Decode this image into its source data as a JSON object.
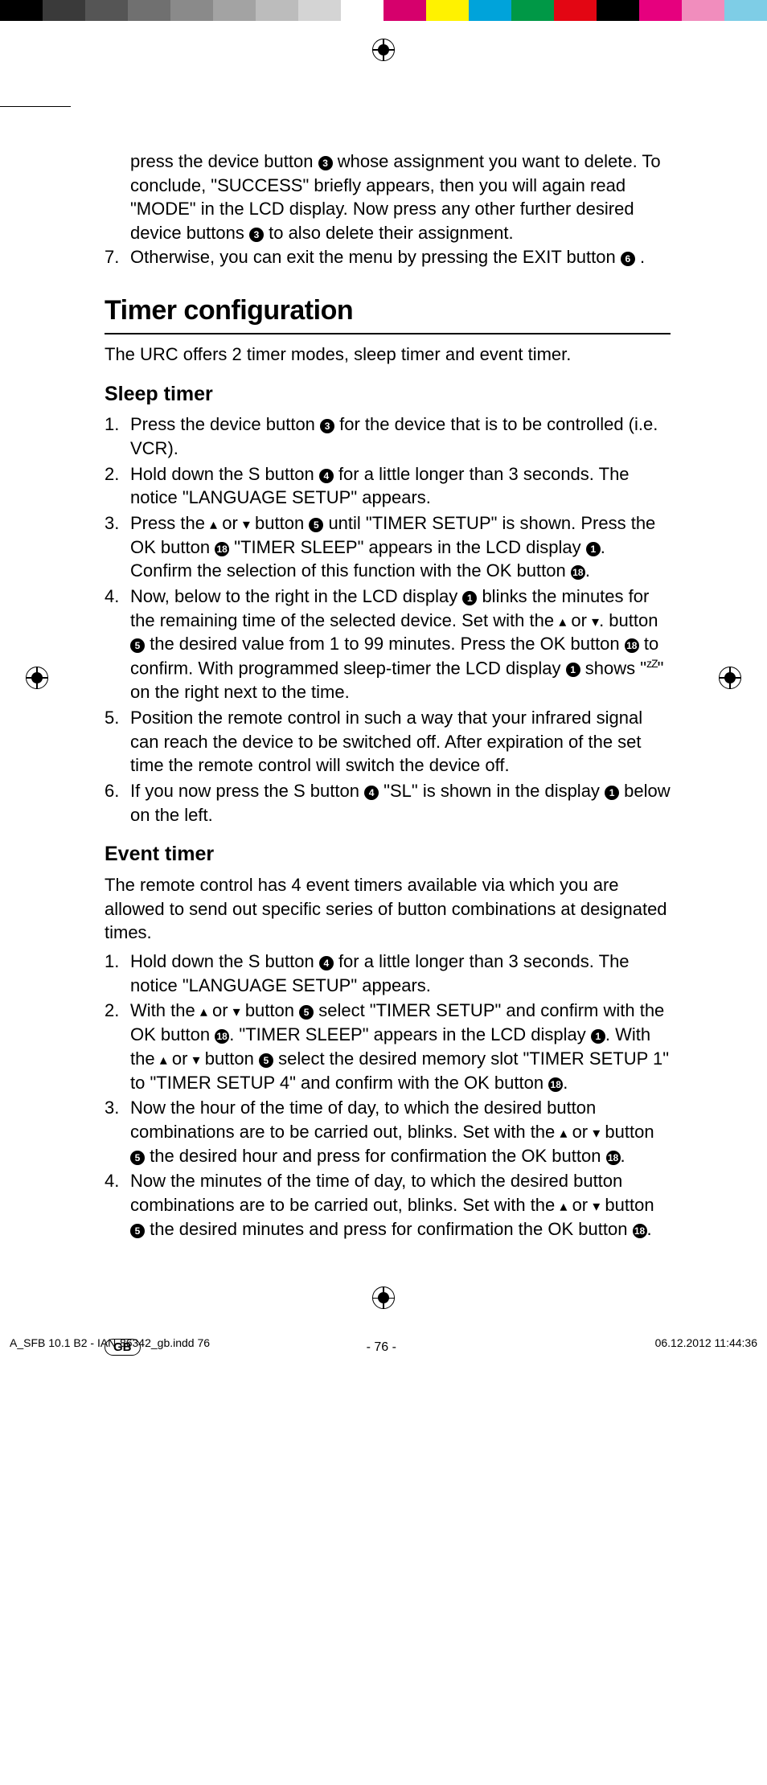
{
  "colorbar": [
    "#000000",
    "#3a3a3a",
    "#555555",
    "#707070",
    "#8a8a8a",
    "#a3a3a3",
    "#bcbcbc",
    "#d4d4d4",
    "#ffffff",
    "#d6006c",
    "#fff200",
    "#00a3da",
    "#009846",
    "#e30613",
    "#000000",
    "#e6007e",
    "#f18dbd",
    "#7ecde6"
  ],
  "continued": {
    "p1_a": "press the device button ",
    "p1_ref1": "3",
    "p1_b": " whose assignment you want to delete. To conclude, \"SUCCESS\" briefly appears, then you will again read \"MODE\" in the LCD display. Now press any other further desired device buttons ",
    "p1_ref2": "3",
    "p1_c": " to also delete their assignment.",
    "li7_num": "7.",
    "li7_a": "Otherwise, you can exit the menu by pressing the EXIT button ",
    "li7_ref": "6",
    "li7_b": "."
  },
  "h1": "Timer configuration",
  "intro1": "The URC offers 2 timer modes, sleep timer and event timer.",
  "h2a": "Sleep timer",
  "sleep": [
    {
      "num": "1.",
      "parts": [
        {
          "t": "Press the device button "
        },
        {
          "c": "3"
        },
        {
          "t": " for the device that is to be controlled (i.e. VCR)."
        }
      ]
    },
    {
      "num": "2.",
      "parts": [
        {
          "t": "Hold down the S button "
        },
        {
          "c": "4"
        },
        {
          "t": " for a little longer than 3 seconds. The notice \"LANGUAGE SETUP\" appears."
        }
      ]
    },
    {
      "num": "3.",
      "parts": [
        {
          "t": "Press the "
        },
        {
          "up": true
        },
        {
          "t": " or "
        },
        {
          "dn": true
        },
        {
          "t": " button "
        },
        {
          "c": "5"
        },
        {
          "t": " until \"TIMER SETUP\" is shown. Press the OK button "
        },
        {
          "c": "18"
        },
        {
          "t": " \"TIMER SLEEP\" appears in the LCD display "
        },
        {
          "c": "1"
        },
        {
          "t": ".  Confirm the selection of this function with the OK button "
        },
        {
          "c": "18"
        },
        {
          "t": "."
        }
      ]
    },
    {
      "num": "4.",
      "parts": [
        {
          "t": "Now, below to the right in the LCD display "
        },
        {
          "c": "1"
        },
        {
          "t": " blinks the minutes for the remaining time of the selected device. Set with the "
        },
        {
          "up": true
        },
        {
          "t": " or "
        },
        {
          "dn": true
        },
        {
          "t": ". button "
        },
        {
          "c": "5"
        },
        {
          "t": " the desired value from 1 to 99 minutes. Press the OK button "
        },
        {
          "c": "18"
        },
        {
          "t": " to confirm. With programmed sleep-timer the LCD display "
        },
        {
          "c": "1"
        },
        {
          "t": " shows \""
        },
        {
          "zz": "zZ"
        },
        {
          "t": "\" on the right next to the time."
        }
      ]
    },
    {
      "num": "5.",
      "parts": [
        {
          "t": "Position the remote control in such a way that your infrared signal can reach the device to be switched off. After expiration of the set time the remote control will switch the device off."
        }
      ]
    },
    {
      "num": "6.",
      "parts": [
        {
          "t": "If you now press the S button "
        },
        {
          "c": "4"
        },
        {
          "t": " \"SL\" is shown in the display "
        },
        {
          "c": "1"
        },
        {
          "t": " below on the left."
        }
      ]
    }
  ],
  "h2b": "Event timer",
  "intro2": "The remote control has 4 event timers available via which you are allowed to send out specific series of button combinations at designated times.",
  "event": [
    {
      "num": "1.",
      "parts": [
        {
          "t": "Hold down the S button "
        },
        {
          "c": "4"
        },
        {
          "t": " for a little longer than 3 seconds. The notice \"LANGUAGE SETUP\" appears."
        }
      ]
    },
    {
      "num": "2.",
      "parts": [
        {
          "t": "With the "
        },
        {
          "up": true
        },
        {
          "t": " or "
        },
        {
          "dn": true
        },
        {
          "t": " button "
        },
        {
          "c": "5"
        },
        {
          "t": " select \"TIMER SETUP\" and confirm with the OK button "
        },
        {
          "c": "18"
        },
        {
          "t": ". \"TIMER SLEEP\" appears in the LCD display "
        },
        {
          "c": "1"
        },
        {
          "t": ".  With the "
        },
        {
          "up": true
        },
        {
          "t": " or "
        },
        {
          "dn": true
        },
        {
          "t": " button "
        },
        {
          "c": "5"
        },
        {
          "t": " select the desired memory slot \"TIMER SETUP 1\" to \"TIMER SETUP 4\" and confirm with the OK button "
        },
        {
          "c": "18"
        },
        {
          "t": "."
        }
      ]
    },
    {
      "num": "3.",
      "parts": [
        {
          "t": "Now the hour of the time of day, to which the desired button combinations are to be carried out, blinks. Set with the "
        },
        {
          "up": true
        },
        {
          "t": " or "
        },
        {
          "dn": true
        },
        {
          "t": " button "
        },
        {
          "c": "5"
        },
        {
          "t": " the desired hour and press for confirmation the OK button "
        },
        {
          "c": "18"
        },
        {
          "t": "."
        }
      ]
    },
    {
      "num": "4.",
      "parts": [
        {
          "t": "Now the minutes of the time of day, to which the desired button combinations are to be carried out, blinks. Set with the "
        },
        {
          "up": true
        },
        {
          "t": " or "
        },
        {
          "dn": true
        },
        {
          "t": " button "
        },
        {
          "c": "5"
        },
        {
          "t": " the desired minutes and press for confirmation the OK button "
        },
        {
          "c": "18"
        },
        {
          "t": "."
        }
      ]
    }
  ],
  "footer": {
    "gb": "GB",
    "pagenum": "- 76 -"
  },
  "slug": {
    "left": "A_SFB 10.1 B2 - IAN-86342_gb.indd   76",
    "right": "06.12.2012   11:44:36"
  }
}
